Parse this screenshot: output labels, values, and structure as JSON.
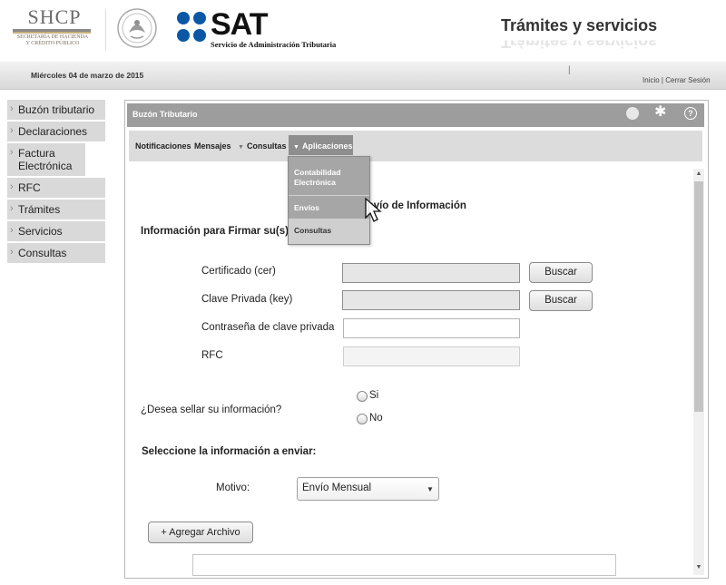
{
  "header": {
    "agency_short": "SHCP",
    "agency_full_line1": "SECRETARÍA DE HACIENDA",
    "agency_full_line2": "Y CRÉDITO PÚBLICO",
    "brand": "SAT",
    "brand_sub": "Servicio de Administración Tributaria",
    "section_title": "Trámites y servicios"
  },
  "datebar": {
    "date": "Miércoles 04 de marzo de 2015",
    "separator": "|",
    "link_home": "Inicio",
    "link_sep": " | ",
    "link_logout": "Cerrar Sesión"
  },
  "leftnav": {
    "items": [
      {
        "label": "Buzón tributario"
      },
      {
        "label": "Declaraciones"
      },
      {
        "label": "Factura Electrónica"
      },
      {
        "label": "RFC"
      },
      {
        "label": "Trámites"
      },
      {
        "label": "Servicios"
      },
      {
        "label": "Consultas"
      }
    ]
  },
  "panel": {
    "title": "Buzón Tributario",
    "help": "?"
  },
  "menu": {
    "notificaciones": "Notificaciones",
    "mensajes": "Mensajes",
    "consultas": "Consultas",
    "aplicaciones": "Aplicaciones"
  },
  "dropdown": {
    "items": [
      {
        "label": "Contabilidad Electrónica"
      },
      {
        "label": "Envíos"
      },
      {
        "label": "Consultas"
      }
    ]
  },
  "form": {
    "page_heading": "Envío de Información",
    "sign_heading": "Información para Firmar su(s) envío(s)",
    "cert_label": "Certificado (cer)",
    "key_label": "Clave Privada (key)",
    "password_label": "Contraseña de clave privada",
    "rfc_label": "RFC",
    "browse_label": "Buscar",
    "seal_question": "¿Desea sellar su información?",
    "option_yes": "Si",
    "option_no": "No",
    "select_heading": "Seleccione la información a enviar:",
    "motivo_label": "Motivo:",
    "motivo_value": "Envío Mensual",
    "add_file_label": "+ Agregar Archivo"
  },
  "icons": {
    "gear": "gear-icon",
    "help": "help-icon",
    "status": "status-icon",
    "caret": "caret-down-icon"
  },
  "colors": {
    "panel_header": "#9d9d9d",
    "menubar": "#dcdcdc",
    "nav_item": "#d9d9d9",
    "sat_dots": "#0a57a6"
  }
}
